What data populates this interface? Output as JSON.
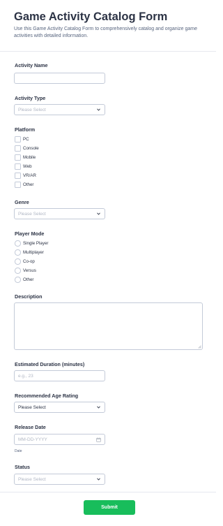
{
  "form": {
    "title": "Game Activity Catalog Form",
    "description": "Use this Game Activity Catalog Form to comprehensively catalog and organize game activities with detailed information."
  },
  "activity_name": {
    "label": "Activity Name",
    "value": ""
  },
  "activity_type": {
    "label": "Activity Type",
    "selected": "Please Select"
  },
  "platform": {
    "label": "Platform",
    "options": [
      "PC",
      "Console",
      "Mobile",
      "Web",
      "VR/AR",
      "Other"
    ]
  },
  "genre": {
    "label": "Genre",
    "selected": "Please Select"
  },
  "player_mode": {
    "label": "Player Mode",
    "options": [
      "Single Player",
      "Multiplayer",
      "Co-op",
      "Versus",
      "Other"
    ]
  },
  "description": {
    "label": "Description",
    "value": ""
  },
  "duration": {
    "label": "Estimated Duration (minutes)",
    "placeholder": "e.g., 23"
  },
  "age_rating": {
    "label": "Recommended Age Rating",
    "selected": "Please Select"
  },
  "release_date": {
    "label": "Release Date",
    "placeholder": "MM-DD-YYYY",
    "sublabel": "Date"
  },
  "status": {
    "label": "Status",
    "selected": "Please Select"
  },
  "submit": {
    "label": "Submit"
  },
  "colors": {
    "accent": "#18bd5b",
    "text": "#2c3345",
    "border": "#c3cad8",
    "placeholder": "#b1b7c4"
  }
}
